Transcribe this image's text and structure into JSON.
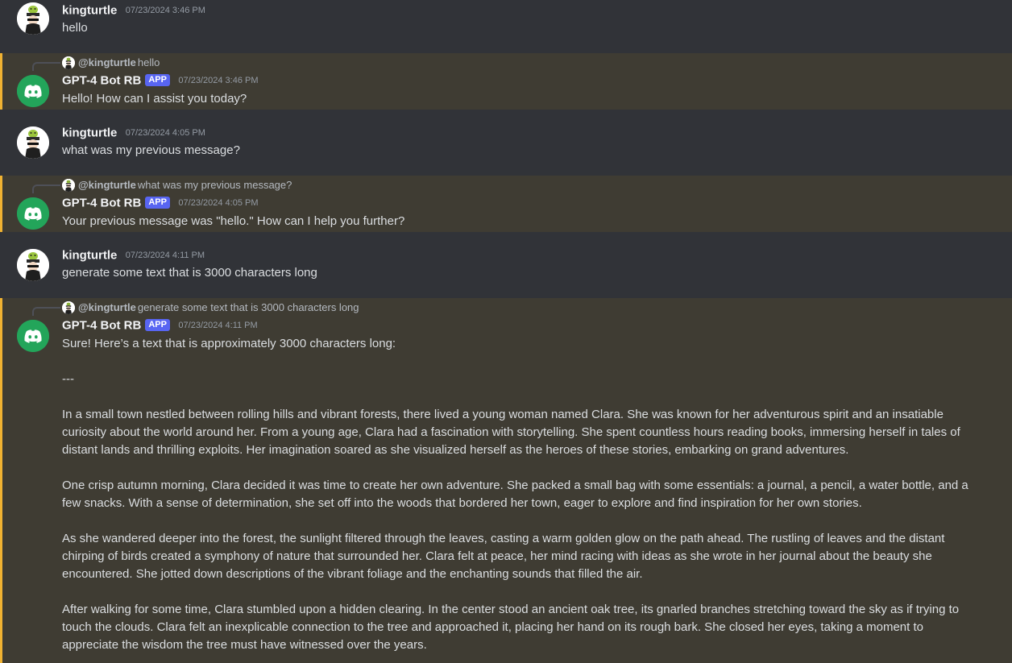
{
  "messages": [
    {
      "author": "kingturtle",
      "time": "07/23/2024 3:46 PM",
      "text": "hello"
    },
    {
      "reply_author": "@kingturtle",
      "reply_text": "hello",
      "author": "GPT-4 Bot RB",
      "badge": "APP",
      "time": "07/23/2024 3:46 PM",
      "text": "Hello! How can I assist you today?"
    },
    {
      "author": "kingturtle",
      "time": "07/23/2024 4:05 PM",
      "text": "what was my previous message?"
    },
    {
      "reply_author": "@kingturtle",
      "reply_text": "what was my previous message?",
      "author": "GPT-4 Bot RB",
      "badge": "APP",
      "time": "07/23/2024 4:05 PM",
      "text": "Your previous message was \"hello.\" How can I help you further?"
    },
    {
      "author": "kingturtle",
      "time": "07/23/2024 4:11 PM",
      "text": "generate some text that is 3000 characters long"
    },
    {
      "reply_author": "@kingturtle",
      "reply_text": "generate some text that is 3000 characters long",
      "author": "GPT-4 Bot RB",
      "badge": "APP",
      "time": "07/23/2024 4:11 PM",
      "paragraphs": [
        "Sure! Here’s a text that is approximately 3000 characters long:",
        "---",
        "In a small town nestled between rolling hills and vibrant forests, there lived a young woman named Clara. She was known for her adventurous spirit and an insatiable curiosity about the world around her. From a young age, Clara had a fascination with storytelling. She spent countless hours reading books, immersing herself in tales of distant lands and thrilling exploits. Her imagination soared as she visualized herself as the heroes of these stories, embarking on grand adventures.",
        "One crisp autumn morning, Clara decided it was time to create her own adventure. She packed a small bag with some essentials: a journal, a pencil, a water bottle, and a few snacks. With a sense of determination, she set off into the woods that bordered her town, eager to explore and find inspiration for her own stories.",
        "As she wandered deeper into the forest, the sunlight filtered through the leaves, casting a warm golden glow on the path ahead. The rustling of leaves and the distant chirping of birds created a symphony of nature that surrounded her. Clara felt at peace, her mind racing with ideas as she wrote in her journal about the beauty she encountered. She jotted down descriptions of the vibrant foliage and the enchanting sounds that filled the air.",
        "After walking for some time, Clara stumbled upon a hidden clearing. In the center stood an ancient oak tree, its gnarled branches stretching toward the sky as if trying to touch the clouds. Clara felt an inexplicable connection to the tree and approached it, placing her hand on its rough bark. She closed her eyes, taking a moment to appreciate the wisdom the tree must have witnessed over the years."
      ]
    }
  ]
}
